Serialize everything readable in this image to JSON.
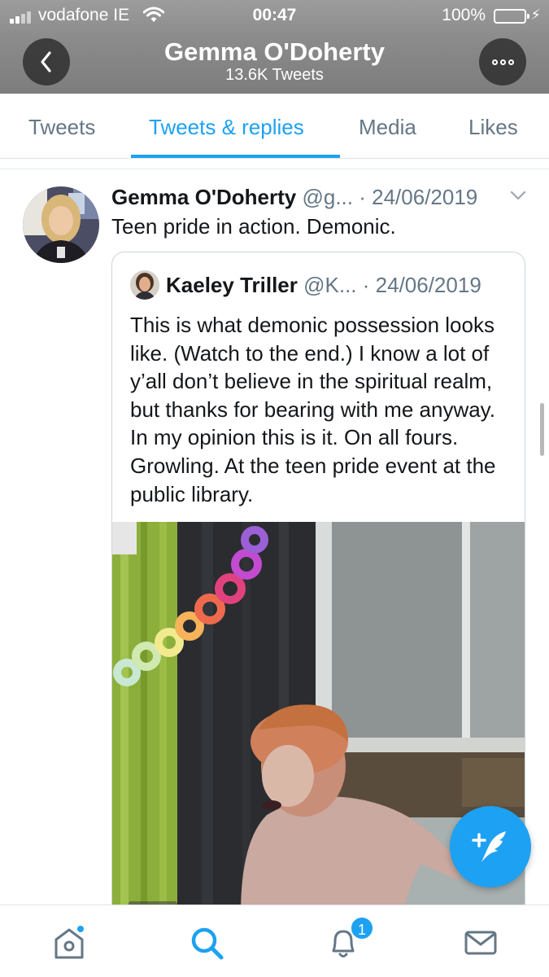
{
  "status_bar": {
    "carrier": "vodafone IE",
    "time": "00:47",
    "battery_percent": "100%",
    "battery_level": 1.0,
    "battery_color": "#4cd964",
    "charging_icon": "bolt-icon"
  },
  "header": {
    "name": "Gemma O'Doherty",
    "tweet_count": "13.6K Tweets",
    "back_icon": "chevron-left-icon",
    "more_icon": "more-dots-icon"
  },
  "tabs": [
    {
      "label": "Tweets",
      "active": false
    },
    {
      "label": "Tweets & replies",
      "active": true
    },
    {
      "label": "Media",
      "active": false
    },
    {
      "label": "Likes",
      "active": false
    }
  ],
  "tweet": {
    "author_name": "Gemma O'Doherty",
    "handle": "@g...",
    "date": "· 24/06/2019",
    "text": "Teen pride in action. Demonic.",
    "quoted": {
      "author_name": "Kaeley Triller",
      "handle": "@K...",
      "date": "· 24/06/2019",
      "text": "This is what demonic possession looks like. (Watch to the end.) I know a lot of y’all don’t believe in the spiritual realm, but thanks for bearing with me anyway. In my opinion this is it. On all fours. Growling. At the teen pride event at the public library."
    }
  },
  "fab": {
    "icon": "compose-tweet-icon"
  },
  "bottom_nav": {
    "items": [
      "home-icon",
      "search-icon",
      "notifications-icon",
      "messages-icon"
    ],
    "notification_badge": "1"
  },
  "colors": {
    "accent": "#1da1f2",
    "secondary_text": "#657786",
    "primary_text": "#14171a"
  }
}
